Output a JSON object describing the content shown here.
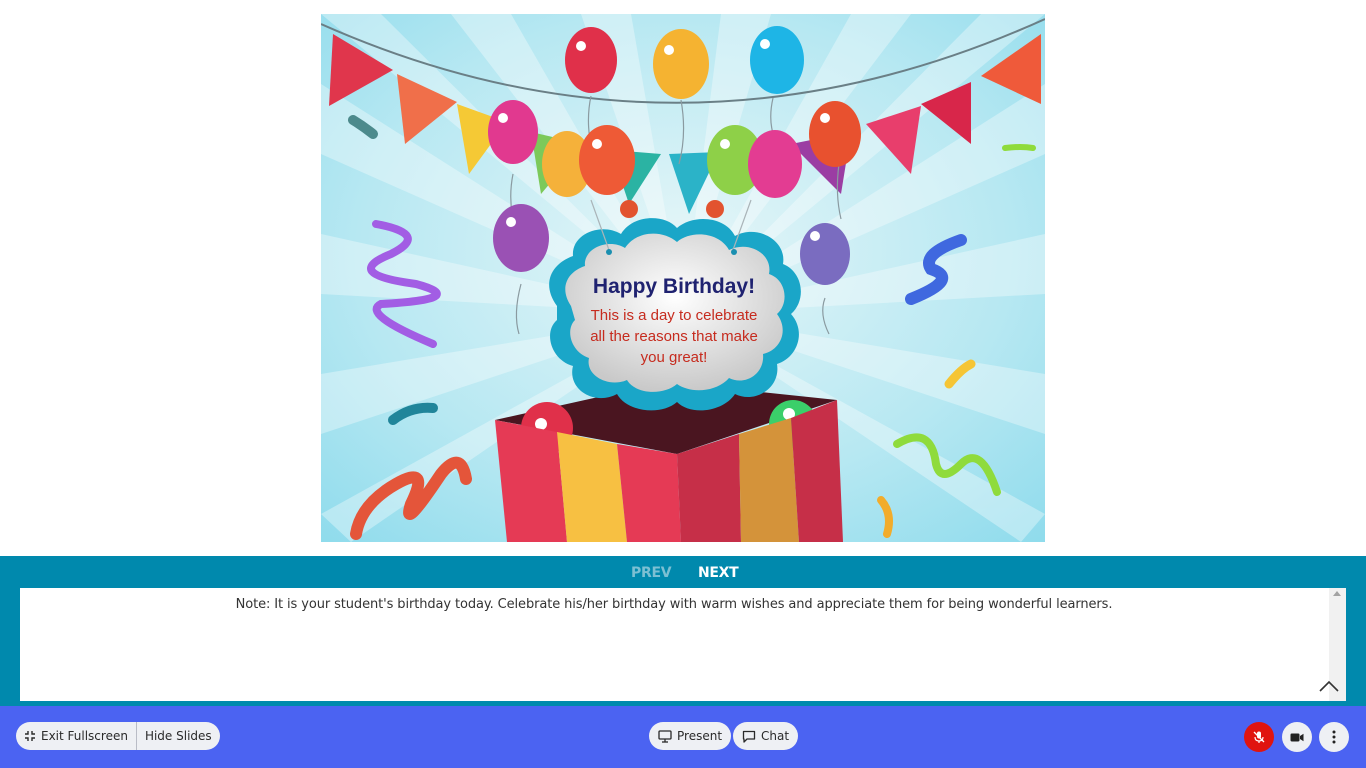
{
  "slide": {
    "card_title": "Happy Birthday!",
    "card_line1": "This is a day to celebrate",
    "card_line2": "all the reasons that make",
    "card_line3": "you great!"
  },
  "navigation": {
    "prev_label": "PREV",
    "next_label": "NEXT"
  },
  "notes": {
    "text": "Note: It is your student's birthday today. Celebrate his/her birthday with warm wishes and appreciate them for being wonderful learners."
  },
  "toolbar": {
    "exit_fullscreen_label": "Exit Fullscreen",
    "hide_slides_label": "Hide Slides",
    "present_label": "Present",
    "chat_label": "Chat",
    "icons": {
      "exit_fullscreen": "minimize-icon",
      "present": "monitor-icon",
      "chat": "chat-bubble-icon",
      "mic": "mic-off-icon",
      "camera": "video-camera-icon",
      "more": "more-vertical-icon"
    }
  },
  "colors": {
    "nav_bar": "#0089ad",
    "toolbar": "#4b63f2",
    "mic_muted": "#e0140f",
    "card_title": "#1f2270",
    "card_text": "#c62b1e"
  }
}
